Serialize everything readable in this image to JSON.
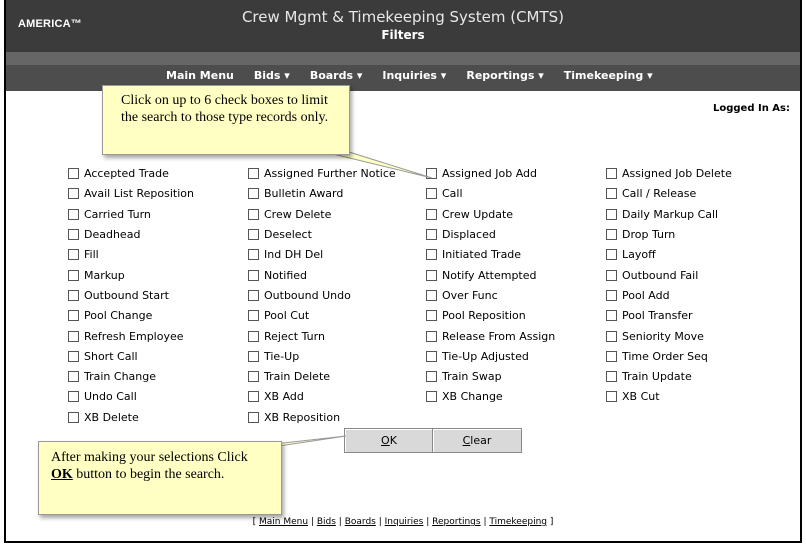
{
  "header": {
    "logo": "AMERICA™",
    "app_title": "Crew Mgmt & Timekeeping System (CMTS)",
    "page_title": "Filters"
  },
  "nav": {
    "items": [
      "Main Menu",
      "Bids ▾",
      "Boards ▾",
      "Inquiries ▾",
      "Reportings ▾",
      "Timekeeping ▾"
    ]
  },
  "logged_in_label": "Logged In As:",
  "checkboxes": {
    "col1": [
      "Accepted Trade",
      "Avail List Reposition",
      "Carried Turn",
      "Deadhead",
      "Fill",
      "Markup",
      "Outbound Start",
      "Pool Change",
      "Refresh Employee",
      "Short Call",
      "Train Change",
      "Undo Call",
      "XB Delete"
    ],
    "col2": [
      "Assigned Further Notice",
      "Bulletin Award",
      "Crew Delete",
      "Deselect",
      "Ind DH Del",
      "Notified",
      "Outbound Undo",
      "Pool Cut",
      "Reject Turn",
      "Tie-Up",
      "Train Delete",
      "XB Add",
      "XB Reposition"
    ],
    "col3": [
      "Assigned Job Add",
      "Call",
      "Crew Update",
      "Displaced",
      "Initiated Trade",
      "Notify Attempted",
      "Over Func",
      "Pool Reposition",
      "Release From Assign",
      "Tie-Up Adjusted",
      "Train Swap",
      "XB Change"
    ],
    "col4": [
      "Assigned Job Delete",
      "Call / Release",
      "Daily Markup Call",
      "Drop Turn",
      "Layoff",
      "Outbound Fail",
      "Pool Add",
      "Pool Transfer",
      "Seniority Move",
      "Time Order Seq",
      "Train Update",
      "XB Cut"
    ]
  },
  "buttons": {
    "ok_hotkey": "O",
    "ok_rest": "K",
    "clear_hotkey": "C",
    "clear_rest": "lear"
  },
  "footer": {
    "open": "[",
    "sep": "|",
    "close": "]",
    "links": [
      "Main Menu",
      "Bids",
      "Boards",
      "Inquiries",
      "Reportings",
      "Timekeeping"
    ]
  },
  "callouts": {
    "top": "Click on up to 6 check boxes to limit the search to those type records only.",
    "bottom_pre": "After making your selections Click ",
    "bottom_bold": "OK",
    "bottom_post": " button to begin the search."
  },
  "colors": {
    "header_bg": "#3b3b3b",
    "nav_bg": "#4d4d4d",
    "callout_bg": "#ffffc4"
  }
}
